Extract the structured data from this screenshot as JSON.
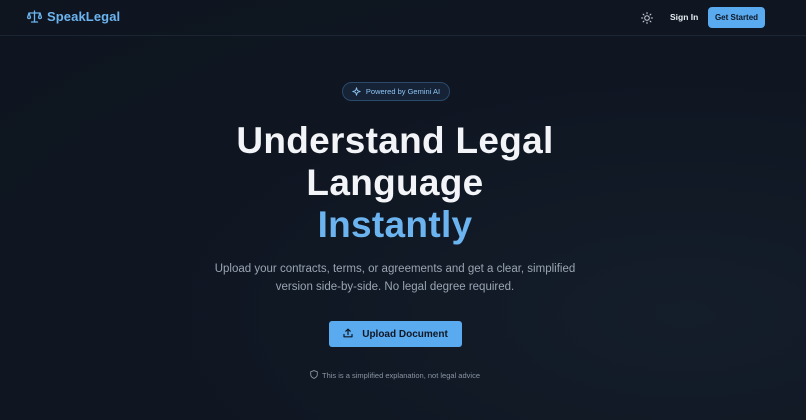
{
  "nav": {
    "brand": "SpeakLegal",
    "brand_icon": "scale-icon",
    "theme_icon": "sun-icon",
    "signin": "Sign In",
    "get_started": "Get Started"
  },
  "hero": {
    "badge_icon": "sparkle-icon",
    "badge": "Powered by Gemini AI",
    "title_line1": "Understand Legal",
    "title_line2": "Language",
    "title_accent": "Instantly",
    "subtitle_line1": "Upload your contracts, terms, or agreements and get a clear, simplified",
    "subtitle_line2": "version side-by-side. No legal degree required.",
    "upload_icon": "upload-icon",
    "upload_button": "Upload Document",
    "disclaimer_icon": "shield-icon",
    "disclaimer": "This is a simplified explanation, not legal advice"
  },
  "colors": {
    "background": "#0f1622",
    "accent": "#5aaaf0",
    "brand_text": "#6cb4f0",
    "heading": "#f2f4f7",
    "muted_text": "#9aa4b2"
  }
}
